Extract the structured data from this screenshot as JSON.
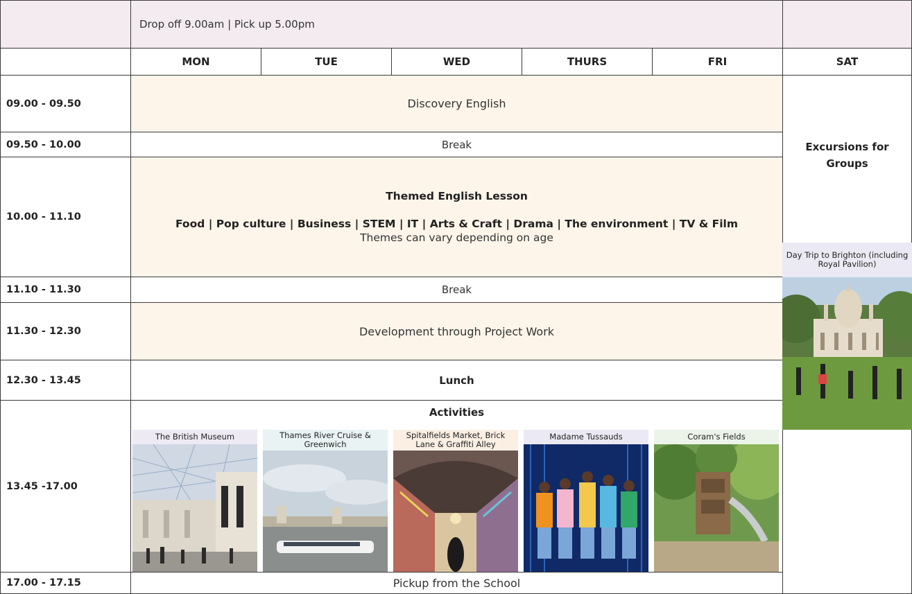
{
  "header": {
    "drop_pick": "Drop off 9.00am | Pick up 5.00pm"
  },
  "days": [
    "MON",
    "TUE",
    "WED",
    "THURS",
    "FRI",
    "SAT"
  ],
  "times": {
    "t1": "09.00 - 09.50",
    "t2": "09.50 - 10.00",
    "t3": "10.00 - 11.10",
    "t4": "11.10 - 11.30",
    "t5": "11.30 - 12.30",
    "t6": "12.30 - 13.45",
    "t7": "13.45 -17.00",
    "t8": "17.00 - 17.15"
  },
  "sessions": {
    "discovery": "Discovery English",
    "break1": "Break",
    "themed_title": "Themed English Lesson",
    "themed_list": "Food | Pop culture | Business | STEM | IT | Arts & Craft | Drama | The environment | TV & Film",
    "themed_note": "Themes can vary depending on age",
    "break2": "Break",
    "project": "Development through Project Work",
    "lunch": "Lunch",
    "activities": "Activities",
    "pickup": "Pickup from the School"
  },
  "saturday": {
    "title": "Excursions for Groups",
    "trip": "Day Trip to Brighton (including Royal Pavilion)"
  },
  "activities": [
    {
      "label": "The British Museum",
      "color": "#eeeaf3"
    },
    {
      "label": "Thames River Cruise & Greenwich",
      "color": "#e9f3f3"
    },
    {
      "label": "Spitalfields Market, Brick Lane & Graffiti Alley",
      "color": "#fbefe4"
    },
    {
      "label": "Madame Tussauds",
      "color": "#ebeaf4"
    },
    {
      "label": "Coram's Fields",
      "color": "#ecf4e9"
    }
  ],
  "colors": {
    "header_bg": "#f3ebf0",
    "lesson_bg": "#fdf5ea",
    "border": "#3a3a3a"
  }
}
